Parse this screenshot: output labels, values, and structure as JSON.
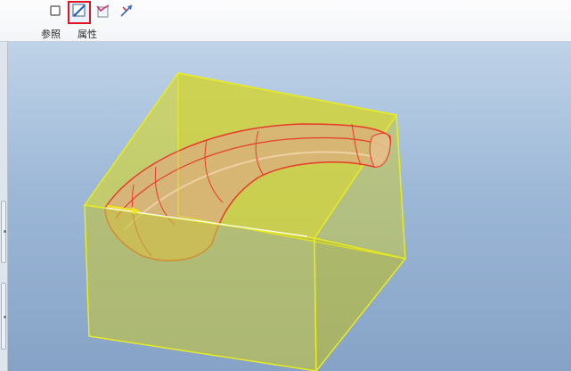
{
  "toolbar": {
    "buttons": [
      {
        "name": "plane-tool",
        "icon": "square-plane-icon"
      },
      {
        "name": "sketch-tool",
        "icon": "sketch-pencil-icon",
        "selected": true
      },
      {
        "name": "trajectory-tool",
        "icon": "trajectory-icon"
      },
      {
        "name": "axis-tool",
        "icon": "axis-arrow-icon"
      }
    ],
    "labels": {
      "references": "参照",
      "properties": "属性"
    },
    "selected_highlight_color": "#e0141e"
  },
  "viewport": {
    "background_top": "#bfd3e8",
    "background_bottom": "#86a2c6",
    "model_fill_color": "#c8cc3a",
    "model_edge_color": "#eeee22",
    "sweep_fill_color": "#d9b27a",
    "sweep_edge_color": "#e83a2a",
    "arrow_color": "#f5e61a"
  }
}
